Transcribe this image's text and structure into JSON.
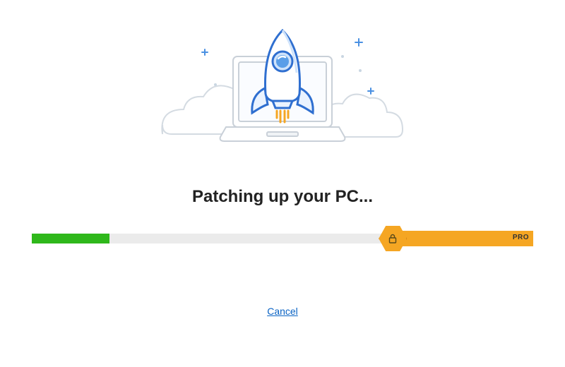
{
  "title": "Patching up your PC...",
  "progress": {
    "green_percent": 15.5,
    "orange_percent": 28,
    "pro_label": "PRO"
  },
  "cancel_label": "Cancel",
  "illustration": {
    "name": "rocket-laptop-illustration"
  },
  "icons": {
    "lock": "lock-icon"
  },
  "colors": {
    "green": "#2fb81b",
    "orange": "#f5a623",
    "track": "#ebebeb",
    "link": "#0a63c4"
  }
}
